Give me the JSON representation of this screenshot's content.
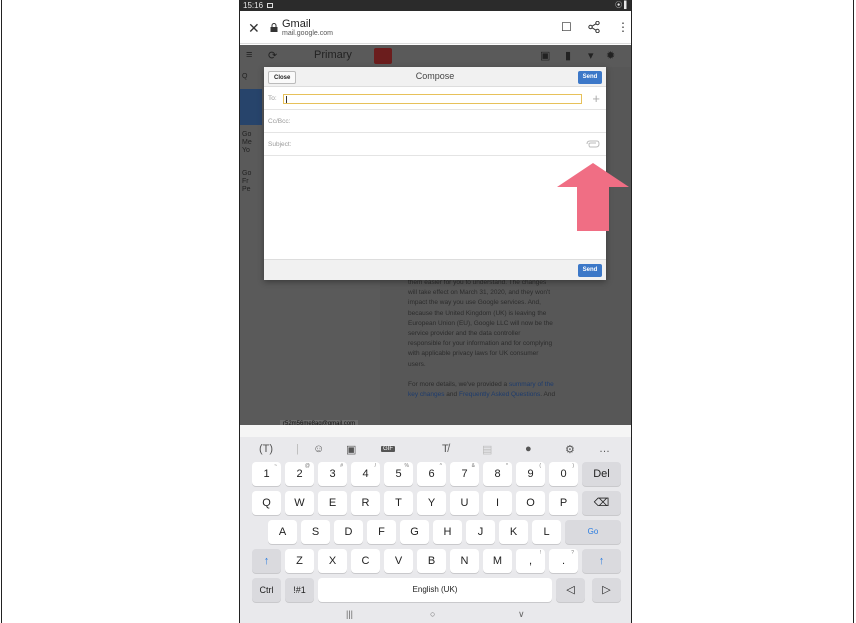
{
  "status": {
    "time": "15:16",
    "right": "⦿ ▌"
  },
  "browser": {
    "title": "Gmail",
    "url": "mail.google.com",
    "close_glyph": "✕",
    "bookmark_glyph": "☐",
    "share_glyph": "<",
    "menu_glyph": "⋮"
  },
  "gmail": {
    "folder": "Primary"
  },
  "inbox_rows": [
    {
      "line1": "Go",
      "line2": "Me",
      "line3": "Yo"
    },
    {
      "line1": "Go",
      "line2": "Fr",
      "line3": "Pe"
    }
  ],
  "compose": {
    "close_label": "Close",
    "title": "Compose",
    "send_label": "Send",
    "to_label": "To:",
    "to_value": "",
    "ccbcc_label": "Cc/Bcc:",
    "subject_label": "Subject:",
    "footer_send_label": "Send"
  },
  "article": {
    "lines": [
      "them easier for you to understand. The changes",
      "will take effect on March 31, 2020, and they won't",
      "impact the way you use Google services. And,",
      "because the United Kingdom (UK) is leaving the",
      "European Union (EU), Google LLC will now be the",
      "service provider and the data controller",
      "responsible for your information and for complying",
      "with applicable privacy laws for UK consumer",
      "users."
    ],
    "more_prefix": "For more details, we've provided a ",
    "more_link": "summary of the",
    "more_line2_link": "key changes",
    "more_line2_mid": " and ",
    "more_line2_link2": "Frequently Asked Questions",
    "more_line2_suffix": ". And"
  },
  "account_email": "r52m56me8ag@gmail.com",
  "keyboard": {
    "toolbar": [
      "(T)",
      "|",
      "☺",
      "▣",
      "GIF",
      "T̸",
      "▤",
      "●",
      "⚙",
      "…"
    ],
    "number_row": [
      {
        "k": "1",
        "s": "~"
      },
      {
        "k": "2",
        "s": "@"
      },
      {
        "k": "3",
        "s": "#"
      },
      {
        "k": "4",
        "s": "/"
      },
      {
        "k": "5",
        "s": "%"
      },
      {
        "k": "6",
        "s": "^"
      },
      {
        "k": "7",
        "s": "&"
      },
      {
        "k": "8",
        "s": "*"
      },
      {
        "k": "9",
        "s": "("
      },
      {
        "k": "0",
        "s": ")"
      }
    ],
    "del_label": "Del",
    "row2": [
      "Q",
      "W",
      "E",
      "R",
      "T",
      "Y",
      "U",
      "I",
      "O",
      "P"
    ],
    "backspace_glyph": "⌫",
    "row3": [
      "A",
      "S",
      "D",
      "F",
      "G",
      "H",
      "J",
      "K",
      "L"
    ],
    "go_label": "Go",
    "shift_glyph": "↑",
    "row4": [
      "Z",
      "X",
      "C",
      "V",
      "B",
      "N",
      "M"
    ],
    "comma": ",",
    "comma_sup": "!",
    "period": ".",
    "period_sup": "?",
    "ctrl_label": "Ctrl",
    "sym_label": "!#1",
    "space_label": "English (UK)",
    "left_glyph": "◁",
    "right_glyph": "▷"
  },
  "navbar": {
    "recents": "|||",
    "home": "○",
    "back": "∨"
  },
  "colors": {
    "send_blue": "#3c78c8",
    "arrow_pink": "#f06e84",
    "focus_yellow": "#e7c15a"
  }
}
